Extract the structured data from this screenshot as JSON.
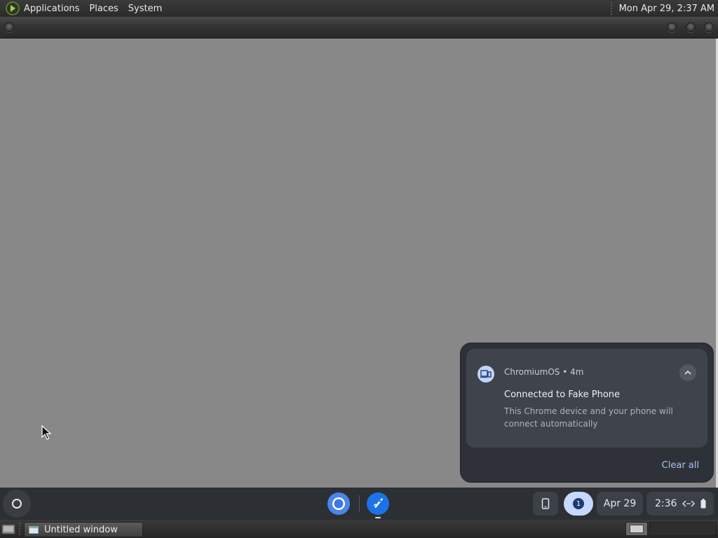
{
  "top_panel": {
    "menus": [
      "Applications",
      "Places",
      "System"
    ],
    "clock": "Mon Apr 29, 2:37 AM",
    "logo_icon": "gnome-foot-icon"
  },
  "window": {
    "title": "Untitled window"
  },
  "notification": {
    "source": "ChromiumOS",
    "separator": "•",
    "age": "4m",
    "title": "Connected to Fake Phone",
    "body": "This Chrome device and your phone will connect automatically",
    "clear_all_label": "Clear all",
    "app_icon": "phone-hub-icon"
  },
  "shelf": {
    "apps": [
      {
        "name": "Chromium",
        "icon": "chrome-icon"
      },
      {
        "name": "Explore",
        "icon": "rocket-icon"
      }
    ],
    "tray": {
      "phone_icon": "phone-icon",
      "notification_count": "1",
      "date": "Apr 29",
      "time": "2:36"
    }
  },
  "bottom_panel": {
    "task_label": "Untitled window"
  },
  "colors": {
    "desktop": "#888888",
    "panel": "#2c2f34",
    "accent": "#a8c4f5"
  }
}
